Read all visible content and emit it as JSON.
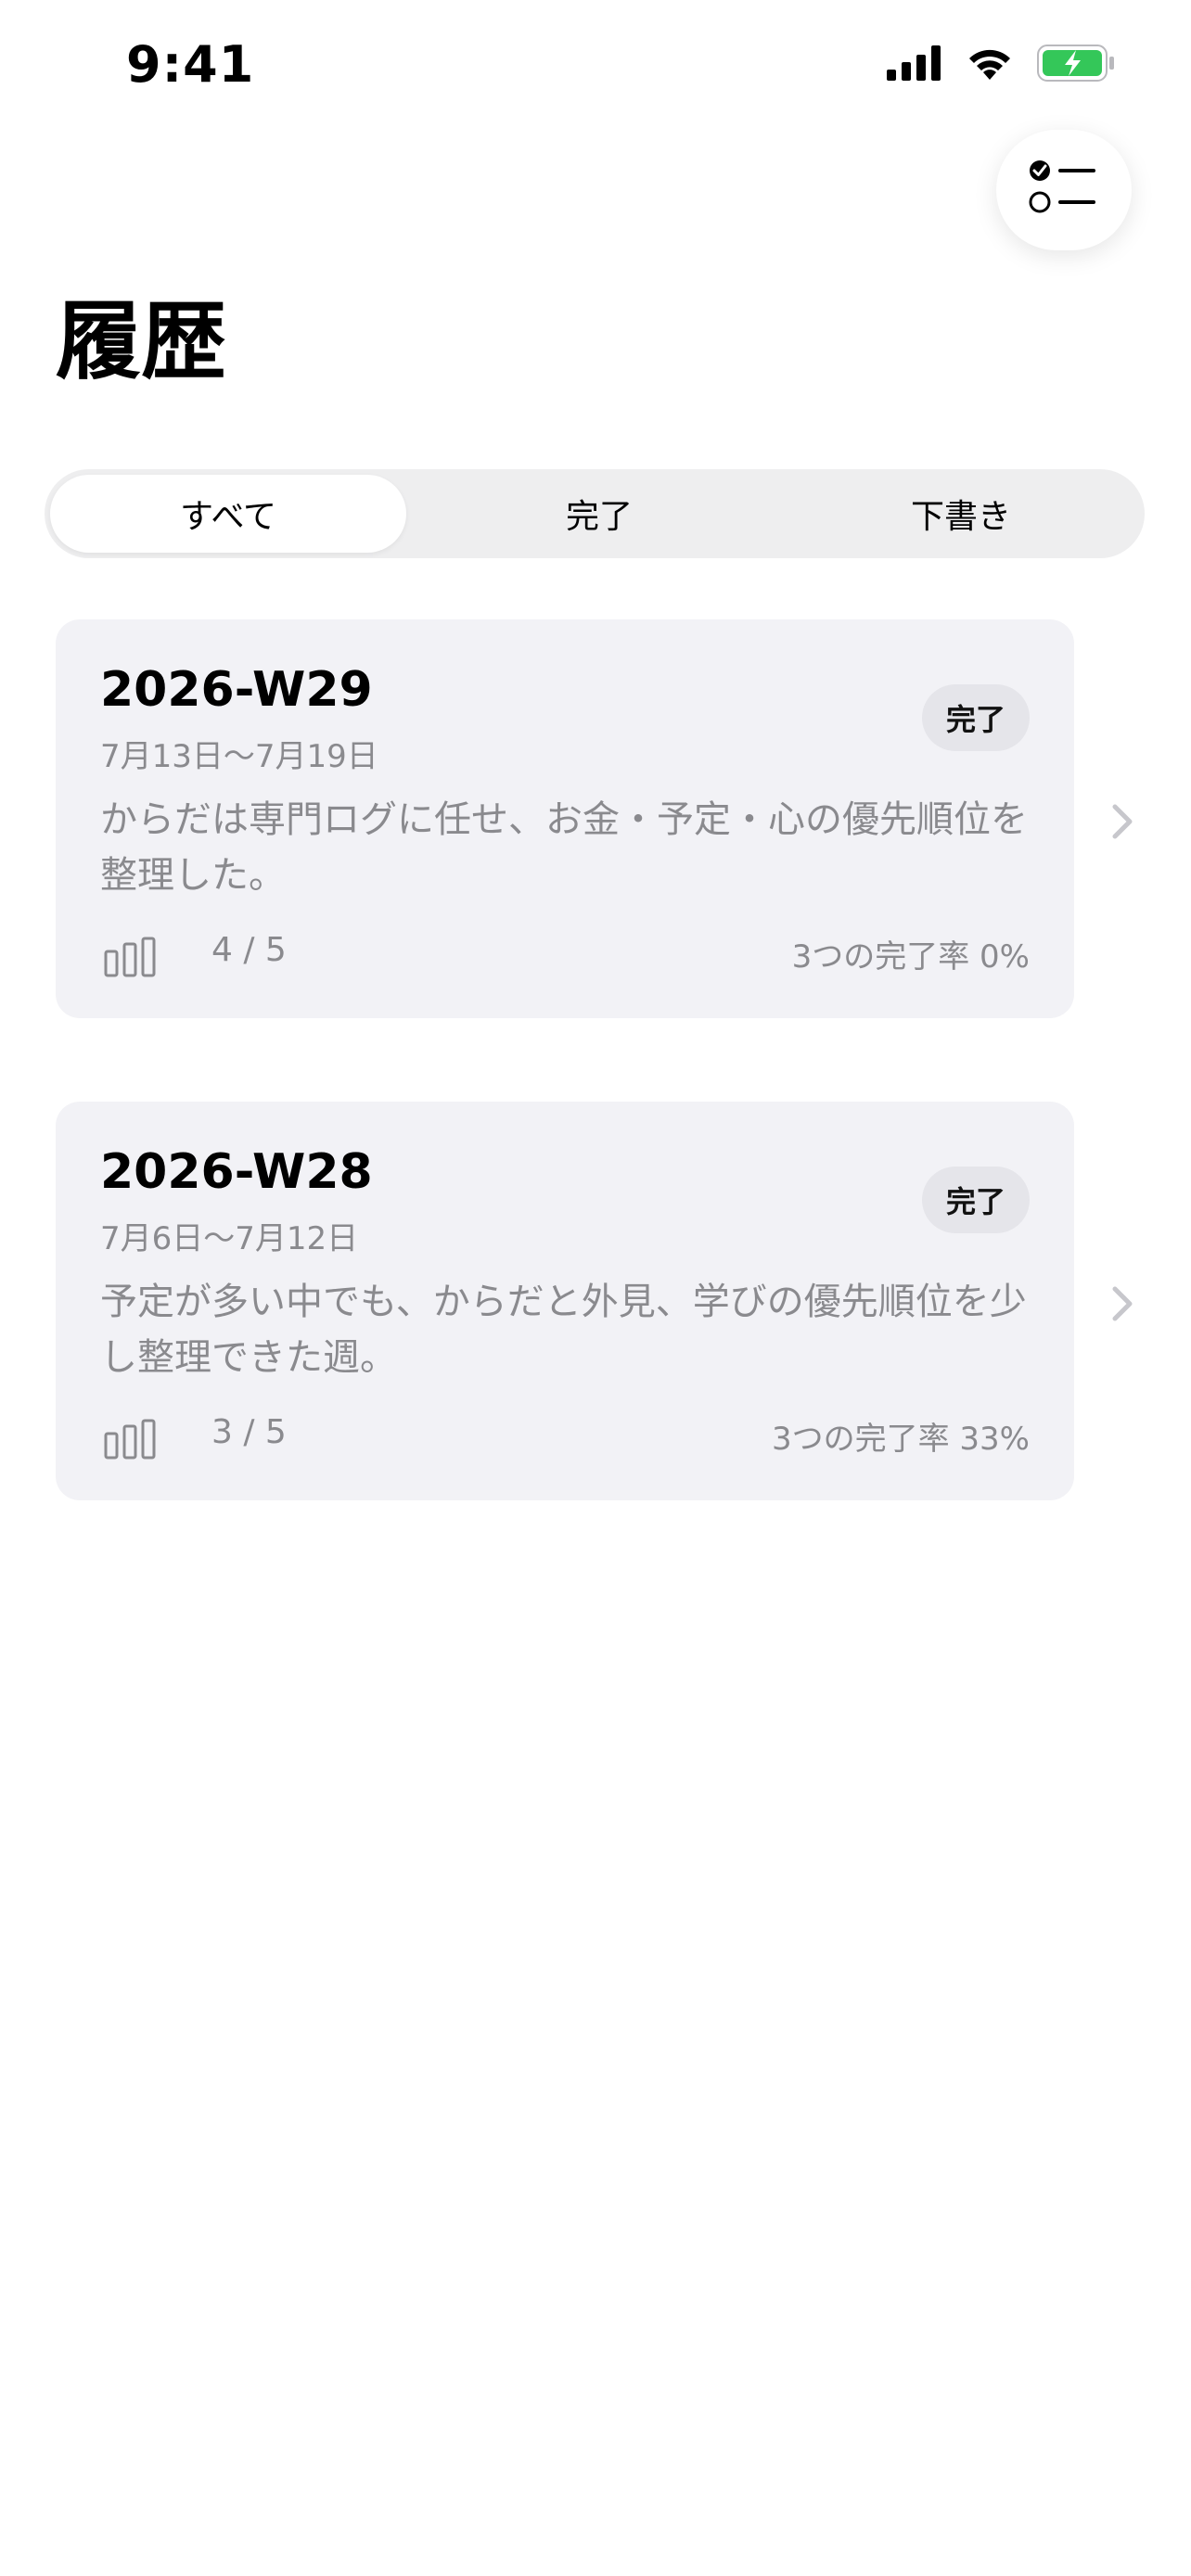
{
  "status_bar": {
    "time": "9:41"
  },
  "header": {
    "title": "履歴",
    "list_button_icon": "checklist-icon"
  },
  "filter": {
    "selected_index": 0,
    "options": [
      "すべて",
      "完了",
      "下書き"
    ]
  },
  "history": [
    {
      "week": "2026-W29",
      "range": "7月13日〜7月19日",
      "summary": "からだは専門ログに任せ、お金・予定・心の優先順位を整理した。",
      "status": "完了",
      "count": "4 / 5",
      "rate": "3つの完了率 0%"
    },
    {
      "week": "2026-W28",
      "range": "7月6日〜7月12日",
      "summary": "予定が多い中でも、からだと外見、学びの優先順位を少し整理できた週。",
      "status": "完了",
      "count": "3 / 5",
      "rate": "3つの完了率 33%"
    }
  ],
  "colors": {
    "card_bg": "#f2f2f6",
    "segment_bg": "#eeeeef",
    "secondary_text": "#8a8a8e",
    "battery_green": "#34c759"
  }
}
